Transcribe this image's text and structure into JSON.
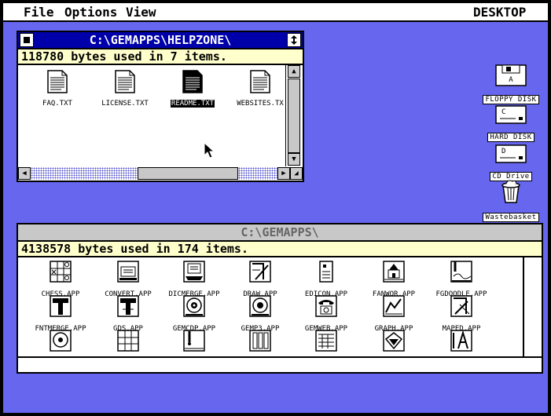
{
  "menubar": {
    "file": "File",
    "options": "Options",
    "view": "View",
    "desktop": "DESKTOP"
  },
  "window_helpzone": {
    "title": "C:\\GEMAPPS\\HELPZONE\\",
    "info": "118780 bytes used in 7 items.",
    "files": [
      {
        "name": "FAQ.TXT",
        "selected": false
      },
      {
        "name": "LICENSE.TXT",
        "selected": false
      },
      {
        "name": "README.TXT",
        "selected": true
      },
      {
        "name": "WEBSITES.TX",
        "selected": false
      }
    ]
  },
  "window_gemapps": {
    "title": "C:\\GEMAPPS\\",
    "info": "4138578 bytes used in 174 items.",
    "row1": [
      {
        "name": "CHESS.APP",
        "icon": "chess-icon"
      },
      {
        "name": "CONVERT.APP",
        "icon": "convert-icon"
      },
      {
        "name": "DICMERGE.APP",
        "icon": "dicmerge-icon"
      },
      {
        "name": "DRAW.APP",
        "icon": "draw-icon"
      },
      {
        "name": "EDICON.APP",
        "icon": "edicon-icon"
      },
      {
        "name": "FANWOR.APP",
        "icon": "fanwor-icon"
      },
      {
        "name": "FGDOODLE.APP",
        "icon": "fgdoodle-icon"
      }
    ],
    "row2": [
      {
        "name": "FNTMERGE.APP",
        "icon": "fntmerge-icon"
      },
      {
        "name": "GDS.APP",
        "icon": "gds-icon"
      },
      {
        "name": "GEMCDP.APP",
        "icon": "cd-player-icon"
      },
      {
        "name": "GEMP3.APP",
        "icon": "mp3-player-icon"
      },
      {
        "name": "GEMWEB.APP",
        "icon": "telephone-icon"
      },
      {
        "name": "GRAPH.APP",
        "icon": "graph-icon"
      },
      {
        "name": "MAPED.APP",
        "icon": "maped-icon"
      }
    ]
  },
  "desktop_icons": [
    {
      "name": "FLOPPY DISK",
      "letter": "A"
    },
    {
      "name": "HARD DISK",
      "letter": "C"
    },
    {
      "name": "CD Drive",
      "letter": "D"
    },
    {
      "name": "Wastebasket",
      "letter": ""
    }
  ],
  "colors": {
    "desktop": "#6666ee",
    "titlebar_active": "#0000aa",
    "infobar": "#ffffcc"
  }
}
